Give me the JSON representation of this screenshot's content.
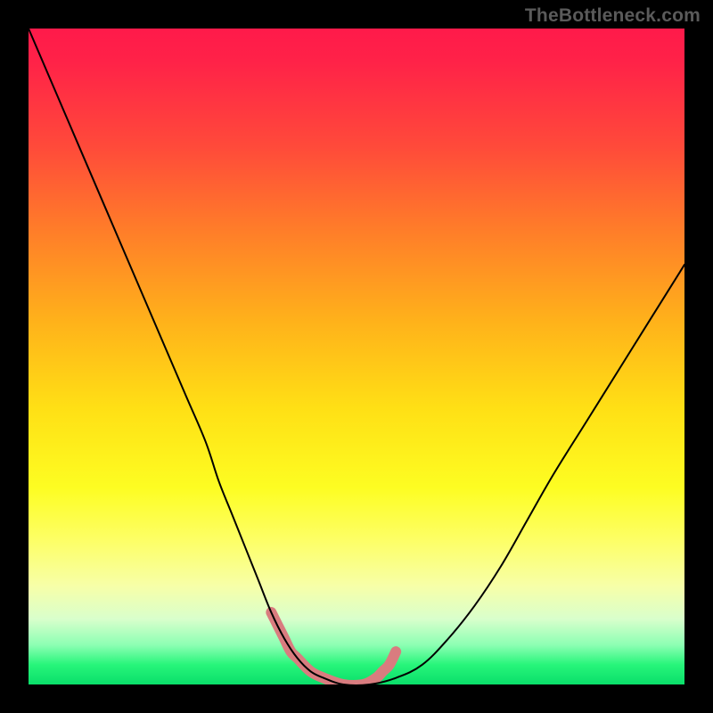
{
  "watermark": "TheBottleneck.com",
  "chart_data": {
    "type": "line",
    "title": "",
    "xlabel": "",
    "ylabel": "",
    "xlim": [
      0,
      100
    ],
    "ylim": [
      0,
      100
    ],
    "grid": false,
    "legend": false,
    "series": [
      {
        "name": "bottleneck-curve",
        "x": [
          0,
          3,
          6,
          9,
          12,
          15,
          18,
          21,
          24,
          27,
          29,
          31,
          33,
          35,
          37,
          39,
          41,
          43,
          45,
          48,
          52,
          56,
          60,
          64,
          68,
          72,
          76,
          80,
          85,
          90,
          95,
          100
        ],
        "values": [
          100,
          93,
          86,
          79,
          72,
          65,
          58,
          51,
          44,
          37,
          31,
          26,
          21,
          16,
          11,
          7,
          4,
          2,
          1,
          0,
          0,
          1,
          3,
          7,
          12,
          18,
          25,
          32,
          40,
          48,
          56,
          64
        ],
        "color": "#000000",
        "stroke_width": 2
      },
      {
        "name": "highlight-band",
        "x": [
          37,
          38,
          39,
          40,
          41,
          43,
          45,
          48,
          51,
          53,
          54,
          55,
          56
        ],
        "values": [
          11,
          9,
          7,
          5,
          4,
          2,
          1,
          0,
          0,
          1,
          2,
          3,
          5
        ],
        "color": "#d97c7f",
        "stroke_width": 12
      }
    ],
    "background_gradient": {
      "direction": "vertical",
      "stops": [
        {
          "pos": 0.0,
          "color": "#ff1a4a"
        },
        {
          "pos": 0.18,
          "color": "#ff4a3a"
        },
        {
          "pos": 0.3,
          "color": "#ff7a2a"
        },
        {
          "pos": 0.45,
          "color": "#ffb31a"
        },
        {
          "pos": 0.58,
          "color": "#ffe015"
        },
        {
          "pos": 0.7,
          "color": "#fdfd22"
        },
        {
          "pos": 0.85,
          "color": "#f7ffa8"
        },
        {
          "pos": 0.94,
          "color": "#8cffb3"
        },
        {
          "pos": 1.0,
          "color": "#0adf6a"
        }
      ]
    }
  }
}
